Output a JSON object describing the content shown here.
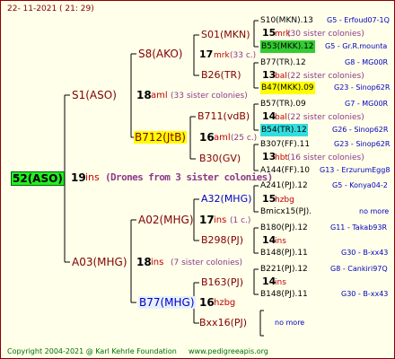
{
  "header": {
    "date": "22- 11-2021 ( 21: 29)"
  },
  "root": {
    "label": "52(ASO)",
    "mating_num": "19",
    "mating_tag": "ins",
    "drones_note": "(Drones from 3 sister colonies)"
  },
  "gen1": [
    {
      "label": "S1(ASO)",
      "num": "18",
      "tag": "aml",
      "sister": "(33 sister colonies)"
    },
    {
      "label": "A03(MHG)",
      "num": "18",
      "tag": "ins",
      "sister": "(7 sister colonies)"
    }
  ],
  "gen2": [
    {
      "label": "S8(AKO)"
    },
    {
      "label": "B712(JtB)",
      "num": "16",
      "tag": "aml",
      "sister": "(25 c.)"
    },
    {
      "label": "A02(MHG)",
      "num": "17",
      "tag": "ins",
      "sister": "(1 c.)"
    },
    {
      "label": "B77(MHG)",
      "num": "16",
      "tag": "hzbg"
    }
  ],
  "gen3": [
    {
      "label": "S01(MKN)",
      "num": "17",
      "tag": "mrk",
      "sister": "(33 c.)"
    },
    {
      "label": "B26(TR)"
    },
    {
      "label": "B711(vdB)",
      "num": "16",
      "tag": "aml",
      "sister": "(25 c.)"
    },
    {
      "label": "B30(GV)"
    },
    {
      "label": "A32(MHG)",
      "num": "15",
      "tag": "hzbg"
    },
    {
      "label": "B298(PJ)"
    },
    {
      "label": "B163(PJ)",
      "num": "14",
      "tag": "ins"
    },
    {
      "label": "Bxx16(PJ)"
    }
  ],
  "gen4": [
    {
      "label": "S10(MKN).13",
      "ref": "G5 - Erfoud07-1Q",
      "num": "15",
      "tag": "mrk",
      "sister": "(30 sister colonies)"
    },
    {
      "label": "B53(MKK).12",
      "ref": "G5 - Gr.R.mounta"
    },
    {
      "label": "B77(TR).12",
      "ref": "G8 - MG00R",
      "num": "13",
      "tag": "bal",
      "sister": "(22 sister colonies)"
    },
    {
      "label": "B47(MKK).09",
      "ref": "G23 - Sinop62R"
    },
    {
      "label": "B57(TR).09",
      "ref": "G7 - MG00R",
      "num": "14",
      "tag": "bal",
      "sister": "(22 sister colonies)"
    },
    {
      "label": "B54(TR).12",
      "ref": "G26 - Sinop62R"
    },
    {
      "label": "B307(FF).11",
      "ref": "G23 - Sinop62R",
      "num": "13",
      "tag": "hbt",
      "sister": "(16 sister colonies)"
    },
    {
      "label": "A144(FF).10",
      "ref": "G13 - ErzurumEgg8"
    },
    {
      "label": "A241(PJ).12",
      "ref": "G5 - Konya04-2",
      "num": "15",
      "tag": "hzbg"
    },
    {
      "label": "Bmicx15(PJ).",
      "ref": "no more"
    },
    {
      "label": "B180(PJ).12",
      "ref": "G11 - Takab93R",
      "num": "14",
      "tag": "ins"
    },
    {
      "label": "B148(PJ).11",
      "ref": "G30 - B-xx43"
    },
    {
      "label": "B221(PJ).12",
      "ref": "G8 - Cankiri97Q",
      "num": "14",
      "tag": "ins"
    },
    {
      "label": "B148(PJ).11",
      "ref": "G30 - B-xx43"
    },
    {
      "label": "",
      "ref": "no more"
    }
  ],
  "footer": {
    "copyright": "Copyright 2004-2021 @ Karl Kehrle Foundation",
    "site": "www.pedigreeapis.org"
  }
}
